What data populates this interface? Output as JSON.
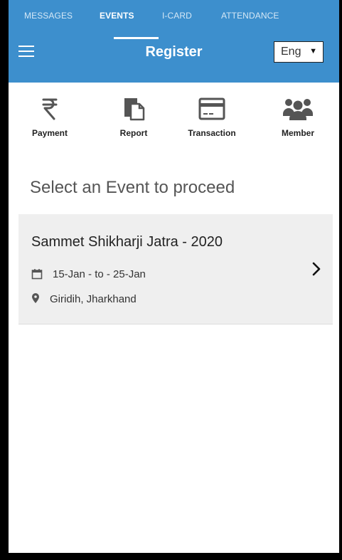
{
  "tabs": [
    {
      "label": "MESSAGES"
    },
    {
      "label": "EVENTS",
      "active": true
    },
    {
      "label": "I-CARD"
    },
    {
      "label": "ATTENDANCE"
    }
  ],
  "toolbar": {
    "title": "Register",
    "language_selected": "Eng"
  },
  "shortcuts": [
    {
      "label": "Payment",
      "icon": "rupee-icon"
    },
    {
      "label": "Report",
      "icon": "report-icon"
    },
    {
      "label": "Transaction",
      "icon": "card-icon"
    },
    {
      "label": "Member",
      "icon": "members-icon"
    }
  ],
  "section_title": "Select an Event to proceed",
  "events": [
    {
      "name": "Sammet Shikharji Jatra - 2020",
      "dates": "15-Jan - to - 25-Jan",
      "location": "Giridih, Jharkhand"
    }
  ],
  "colors": {
    "primary": "#3d8fcd",
    "card_bg": "#efefef"
  }
}
